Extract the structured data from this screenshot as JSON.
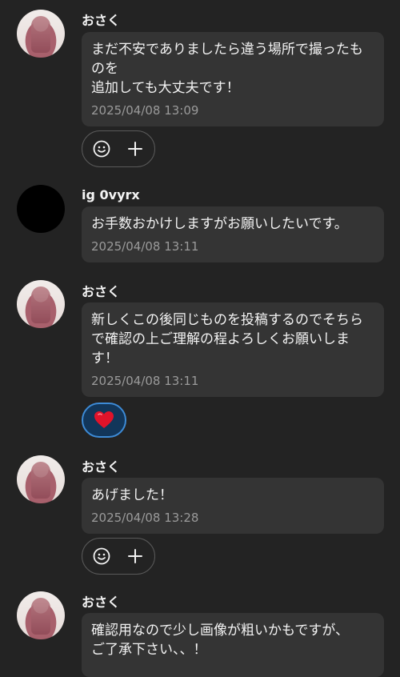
{
  "messages": [
    {
      "sender": "おさく",
      "text": "まだ不安でありましたら違う場所で撮ったものを\n追加しても大丈夫です！",
      "time": "2025/04/08 13:09",
      "avatar": "photo",
      "reaction_bar": "add"
    },
    {
      "sender": "ig 0vyrx",
      "text": "お手数おかけしますがお願いしたいです。",
      "time": "2025/04/08 13:11",
      "avatar": "black",
      "reaction_bar": "none"
    },
    {
      "sender": "おさく",
      "text": "新しくこの後同じものを投稿するのでそちらで確認の上ご理解の程よろしくお願いします！",
      "time": "2025/04/08 13:11",
      "avatar": "photo",
      "reaction_bar": "heart"
    },
    {
      "sender": "おさく",
      "text": "あげました！",
      "time": "2025/04/08 13:28",
      "avatar": "photo",
      "reaction_bar": "add"
    },
    {
      "sender": "おさく",
      "text": "確認用なので少し画像が粗いかもですが、\nご了承下さい、、！",
      "time": "",
      "avatar": "photo",
      "reaction_bar": "none"
    }
  ],
  "colors": {
    "background": "#232323",
    "bubble": "#343434",
    "timestamp": "#9a9a9a",
    "heart": "#e0132a",
    "heart_pill_border": "#3d8bd7"
  },
  "icons": {
    "emoji": "smiley-icon",
    "add": "plus-icon",
    "heart": "heart-icon"
  }
}
